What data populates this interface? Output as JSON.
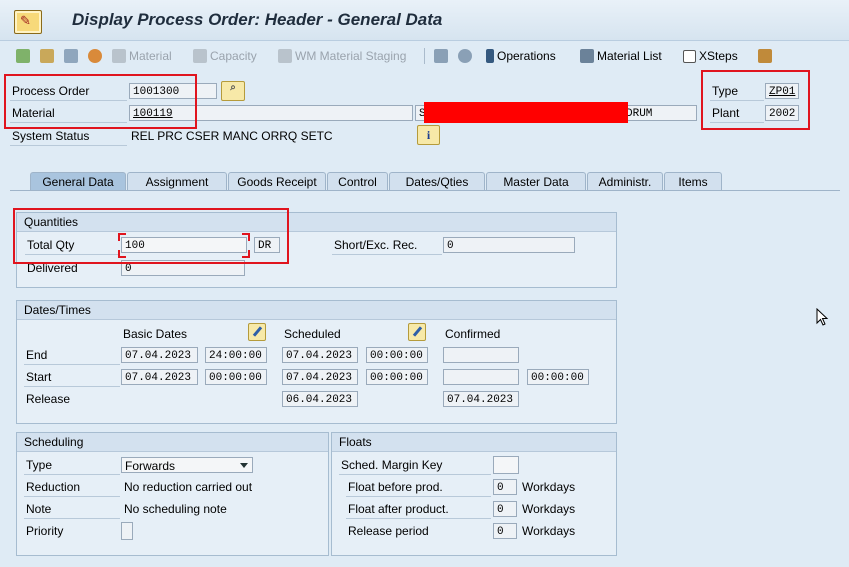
{
  "window": {
    "title": "Display Process Order: Header - General Data"
  },
  "toolbar": {
    "material": "Material",
    "capacity": "Capacity",
    "wm_staging": "WM Material Staging",
    "operations": "Operations",
    "material_list": "Material List",
    "xsteps": "XSteps"
  },
  "header": {
    "process_order_label": "Process Order",
    "process_order_value": "1001300",
    "material_label": "Material",
    "material_value": "100119",
    "material_desc_tail": "DRUM",
    "material_desc_prefix": "S",
    "system_status_label": "System Status",
    "system_status_value": "REL  PRC  CSER MANC ORRQ SETC",
    "type_label": "Type",
    "type_value": "ZP01",
    "plant_label": "Plant",
    "plant_value": "2002",
    "info_icon": "i"
  },
  "tabs": [
    "General Data",
    "Assignment",
    "Goods Receipt",
    "Control",
    "Dates/Qties",
    "Master Data",
    "Administr.",
    "Items"
  ],
  "quantities": {
    "title": "Quantities",
    "total_qty_label": "Total Qty",
    "total_qty_value": "100",
    "unit": "DR",
    "short_exc_label": "Short/Exc. Rec.",
    "short_exc_value": "0",
    "delivered_label": "Delivered",
    "delivered_value": "0"
  },
  "dates": {
    "title": "Dates/Times",
    "basic_dates_label": "Basic Dates",
    "scheduled_label": "Scheduled",
    "confirmed_label": "Confirmed",
    "end_label": "End",
    "start_label": "Start",
    "release_label": "Release",
    "end_basic_date": "07.04.2023",
    "end_basic_time": "24:00:00",
    "end_sched_date": "07.04.2023",
    "end_sched_time": "00:00:00",
    "end_conf_date": "",
    "start_basic_date": "07.04.2023",
    "start_basic_time": "00:00:00",
    "start_sched_date": "07.04.2023",
    "start_sched_time": "00:00:00",
    "start_conf_date": "",
    "start_conf_time": "00:00:00",
    "release_sched_date": "06.04.2023",
    "release_conf_date": "07.04.2023"
  },
  "scheduling": {
    "title": "Scheduling",
    "type_label": "Type",
    "type_value": "Forwards",
    "reduction_label": "Reduction",
    "reduction_value": "No reduction carried out",
    "note_label": "Note",
    "note_value": "No scheduling note",
    "priority_label": "Priority"
  },
  "floats": {
    "title": "Floats",
    "sched_margin_label": "Sched. Margin Key",
    "float_before_label": "Float before prod.",
    "float_before_value": "0",
    "float_after_label": "Float after product.",
    "float_after_value": "0",
    "release_period_label": "Release period",
    "release_period_value": "0",
    "unit": "Workdays"
  },
  "colors": {
    "redaction": "#ff0000",
    "highlight": "#e0141e",
    "background": "#dfebf5"
  }
}
